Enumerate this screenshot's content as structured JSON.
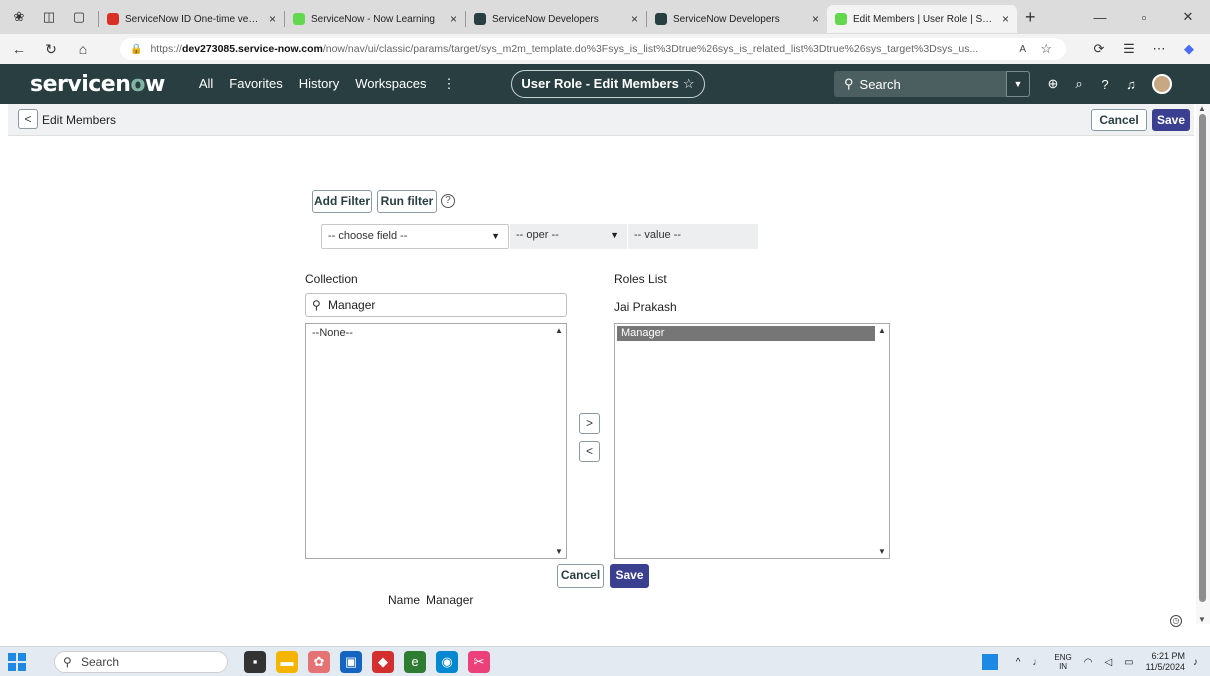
{
  "browser": {
    "tabs": [
      {
        "title": "ServiceNow ID One-time verificati",
        "color": "#d93025",
        "active": false
      },
      {
        "title": "ServiceNow - Now Learning",
        "color": "#62d84e",
        "active": false
      },
      {
        "title": "ServiceNow Developers",
        "color": "#293e40",
        "active": false
      },
      {
        "title": "ServiceNow Developers",
        "color": "#293e40",
        "active": false
      },
      {
        "title": "Edit Members | User Role | Servic",
        "color": "#62d84e",
        "active": true
      }
    ],
    "url_prefix": "https://",
    "url_domain": "dev273085.service-now.com",
    "url_path": "/now/nav/ui/classic/params/target/sys_m2m_template.do%3Fsys_is_list%3Dtrue%26sys_is_related_list%3Dtrue%26sys_target%3Dsys_us..."
  },
  "sn_header": {
    "logo_a": "servicen",
    "logo_o": "o",
    "logo_b": "w",
    "nav": [
      "All",
      "Favorites",
      "History",
      "Workspaces",
      "⋮"
    ],
    "pill_title": "User Role - Edit Members",
    "search_placeholder": "Search"
  },
  "page": {
    "title": "Edit Members",
    "cancel_label": "Cancel",
    "save_label": "Save"
  },
  "filter": {
    "add_filter": "Add Filter",
    "run_filter": "Run filter",
    "field_placeholder": "-- choose field --",
    "oper_placeholder": "-- oper --",
    "value_placeholder": "-- value --"
  },
  "collection": {
    "label": "Collection",
    "search_value": "Manager",
    "items": [
      "--None--"
    ]
  },
  "roles": {
    "label": "Roles List",
    "owner": "Jai Prakash",
    "items": [
      "Manager"
    ]
  },
  "footer": {
    "cancel_label": "Cancel",
    "save_label": "Save",
    "name_label": "Name",
    "name_value": "Manager"
  },
  "taskbar": {
    "search_placeholder": "Search",
    "lang_top": "ENG",
    "lang_bottom": "IN",
    "time": "6:21 PM",
    "date": "11/5/2024"
  },
  "colors": {
    "sn_header_bg": "#293e40",
    "primary_button": "#3a3f8f"
  }
}
